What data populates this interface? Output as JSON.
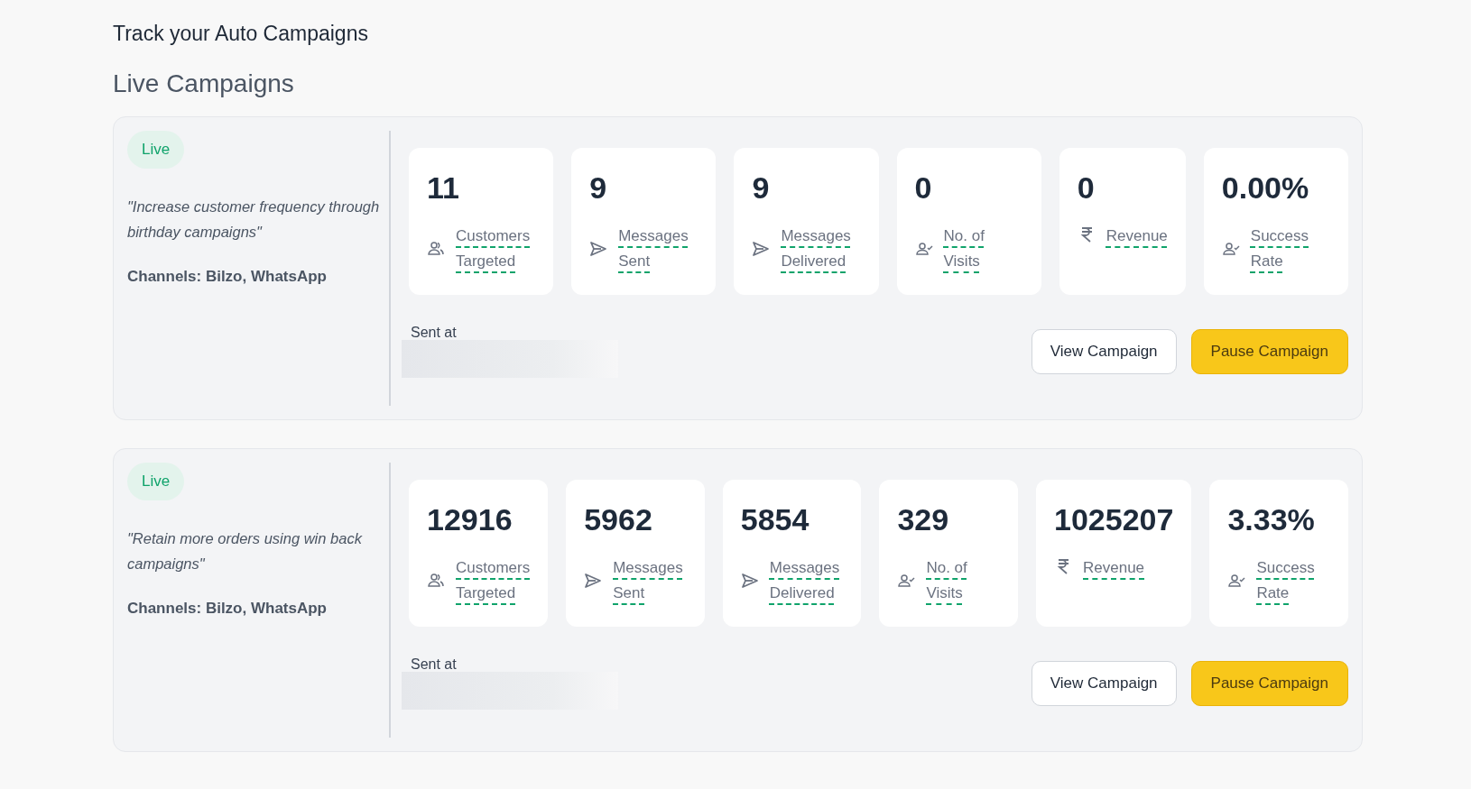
{
  "page_title": "Track your Auto Campaigns",
  "section_title": "Live Campaigns",
  "campaigns": [
    {
      "status": "Live",
      "description": "\"Increase customer frequency through birthday campaigns\"",
      "channels": "Channels: Bilzo, WhatsApp",
      "metrics": [
        {
          "kind": "people",
          "value": "11",
          "label": "Customers Targeted"
        },
        {
          "kind": "send",
          "value": "9",
          "label": "Messages Sent"
        },
        {
          "kind": "send",
          "value": "9",
          "label": "Messages Delivered"
        },
        {
          "kind": "person-check",
          "value": "0",
          "label": "No. of Visits"
        },
        {
          "kind": "rupee",
          "value": "0",
          "label": "Revenue"
        },
        {
          "kind": "person-check",
          "value": "0.00%",
          "label": "Success Rate"
        }
      ],
      "sent_at_label": "Sent at",
      "buttons": [
        {
          "kind": "secondary",
          "label": "View Campaign"
        },
        {
          "kind": "primary",
          "label": "Pause Campaign"
        }
      ]
    },
    {
      "status": "Live",
      "description": "\"Retain more orders using win back campaigns\"",
      "channels": "Channels: Bilzo, WhatsApp",
      "metrics": [
        {
          "kind": "people",
          "value": "12916",
          "label": "Customers Targeted"
        },
        {
          "kind": "send",
          "value": "5962",
          "label": "Messages Sent"
        },
        {
          "kind": "send",
          "value": "5854",
          "label": "Messages Delivered"
        },
        {
          "kind": "person-check",
          "value": "329",
          "label": "No. of Visits"
        },
        {
          "kind": "rupee",
          "value": "1025207",
          "label": "Revenue"
        },
        {
          "kind": "person-check",
          "value": "3.33%",
          "label": "Success Rate"
        }
      ],
      "sent_at_label": "Sent at",
      "buttons": [
        {
          "kind": "secondary",
          "label": "View Campaign"
        },
        {
          "kind": "primary",
          "label": "Pause Campaign"
        }
      ]
    }
  ]
}
